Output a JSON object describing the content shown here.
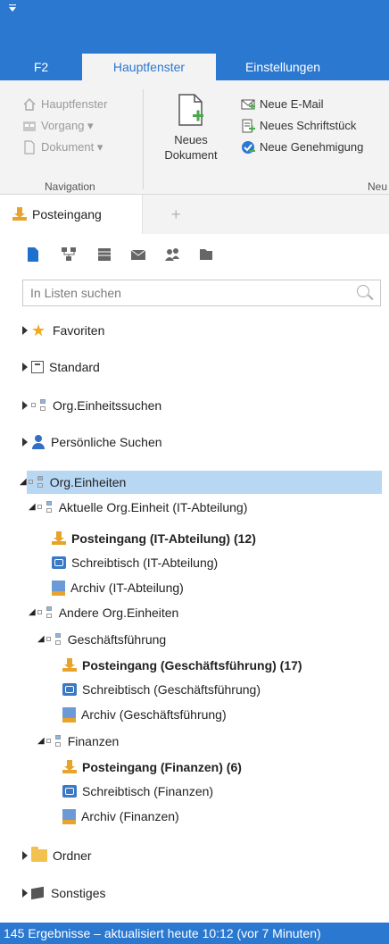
{
  "ribbon_tabs": [
    "F2",
    "Hauptfenster",
    "Einstellungen"
  ],
  "ribbon": {
    "navigation": {
      "items": [
        "Hauptfenster",
        "Vorgang ▾",
        "Dokument ▾"
      ],
      "label": "Navigation"
    },
    "neu": {
      "big_button": [
        "Neues",
        "Dokument"
      ],
      "items": [
        "Neue E-Mail",
        "Neues Schriftstück",
        "Neue Genehmigung"
      ],
      "label": "Neu"
    }
  },
  "doc_tab": "Posteingang",
  "search": {
    "placeholder": "In Listen suchen"
  },
  "tree": {
    "favoriten": "Favoriten",
    "standard": "Standard",
    "org_suchen": "Org.Einheitssuchen",
    "persoenliche": "Persönliche Suchen",
    "org_einheiten": "Org.Einheiten",
    "aktuelle": "Aktuelle Org.Einheit (IT-Abteilung)",
    "it_post": "Posteingang (IT-Abteilung) (12)",
    "it_desk": "Schreibtisch (IT-Abteilung)",
    "it_arch": "Archiv (IT-Abteilung)",
    "andere": "Andere Org.Einheiten",
    "gf": "Geschäftsführung",
    "gf_post": "Posteingang (Geschäftsführung) (17)",
    "gf_desk": "Schreibtisch (Geschäftsführung)",
    "gf_arch": "Archiv (Geschäftsführung)",
    "fin": "Finanzen",
    "fin_post": "Posteingang (Finanzen) (6)",
    "fin_desk": "Schreibtisch (Finanzen)",
    "fin_arch": "Archiv (Finanzen)",
    "ordner": "Ordner",
    "sonstiges": "Sonstiges"
  },
  "status": "145 Ergebnisse – aktualisiert heute 10:12 (vor 7 Minuten)",
  "colors": {
    "accent": "#2b78d0",
    "selection": "#b8d7f3"
  }
}
